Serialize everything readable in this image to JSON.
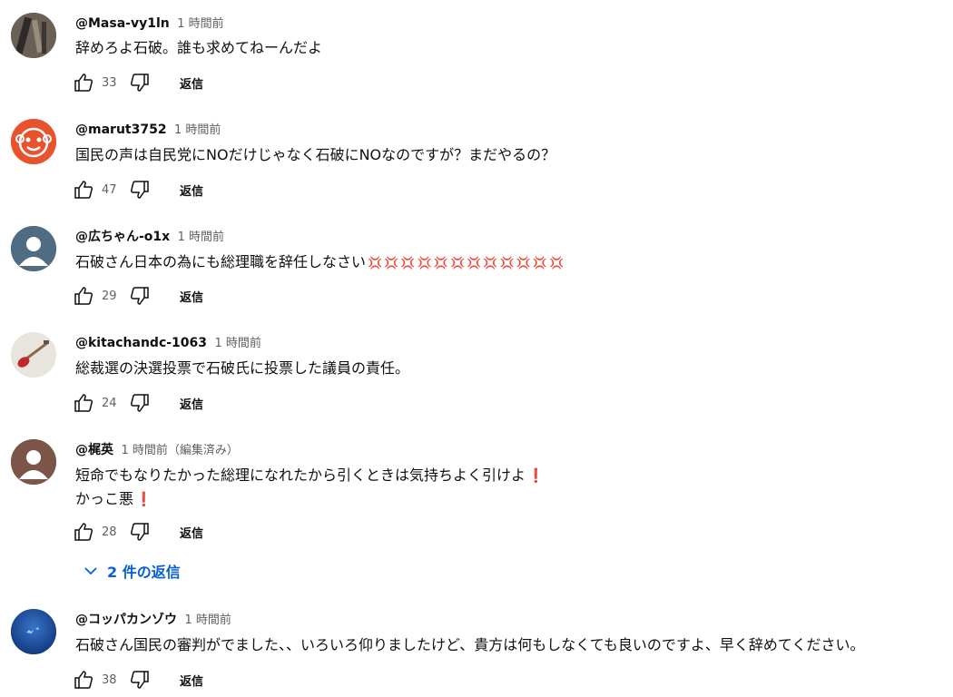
{
  "comments": [
    {
      "author": "@Masa-vy1ln",
      "time": "1 時間前",
      "lines": [
        "辞めろよ石破。誰も求めてねーんだよ"
      ],
      "likes": "33",
      "reply_label": "返信"
    },
    {
      "author": "@marut3752",
      "time": "1 時間前",
      "lines": [
        "国民の声は自民党にNOだけじゃなく石破にNOなのですが？まだやるの？"
      ],
      "likes": "47",
      "reply_label": "返信"
    },
    {
      "author": "@広ちゃん-o1x",
      "time": "1 時間前",
      "lines": [
        "石破さん日本の為にも総理職を辞任しなさい"
      ],
      "emoji": "💢💢💢💢💢💢💢💢💢💢💢💢",
      "likes": "29",
      "reply_label": "返信"
    },
    {
      "author": "@kitachandc-1063",
      "time": "1 時間前",
      "lines": [
        "総裁選の決選投票で石破氏に投票した議員の責任。"
      ],
      "likes": "24",
      "reply_label": "返信"
    },
    {
      "author": "@梶英",
      "time": "1 時間前（編集済み）",
      "lines": [
        "短命でもなりたかった総理になれたから引くときは気持ちよく引けよ",
        "かっこ悪"
      ],
      "line_emoji": "❗",
      "likes": "28",
      "reply_label": "返信"
    },
    {
      "author": "@コッパカンゾウ",
      "time": "1 時間前",
      "lines": [
        "石破さん国民の審判がでました、、いろいろ仰りましたけど、貴方は何もしなくても良いのですよ、早く辞めてください。"
      ],
      "likes": "38",
      "reply_label": "返信"
    }
  ],
  "replies_toggle": {
    "label": "2 件の返信"
  },
  "colors": {
    "link": "#065fd4",
    "muted": "#606060",
    "emoji_red": "#d62222"
  },
  "icons": {
    "like": "thumbs-up-icon",
    "dislike": "thumbs-down-icon",
    "expand": "chevron-down-icon"
  }
}
